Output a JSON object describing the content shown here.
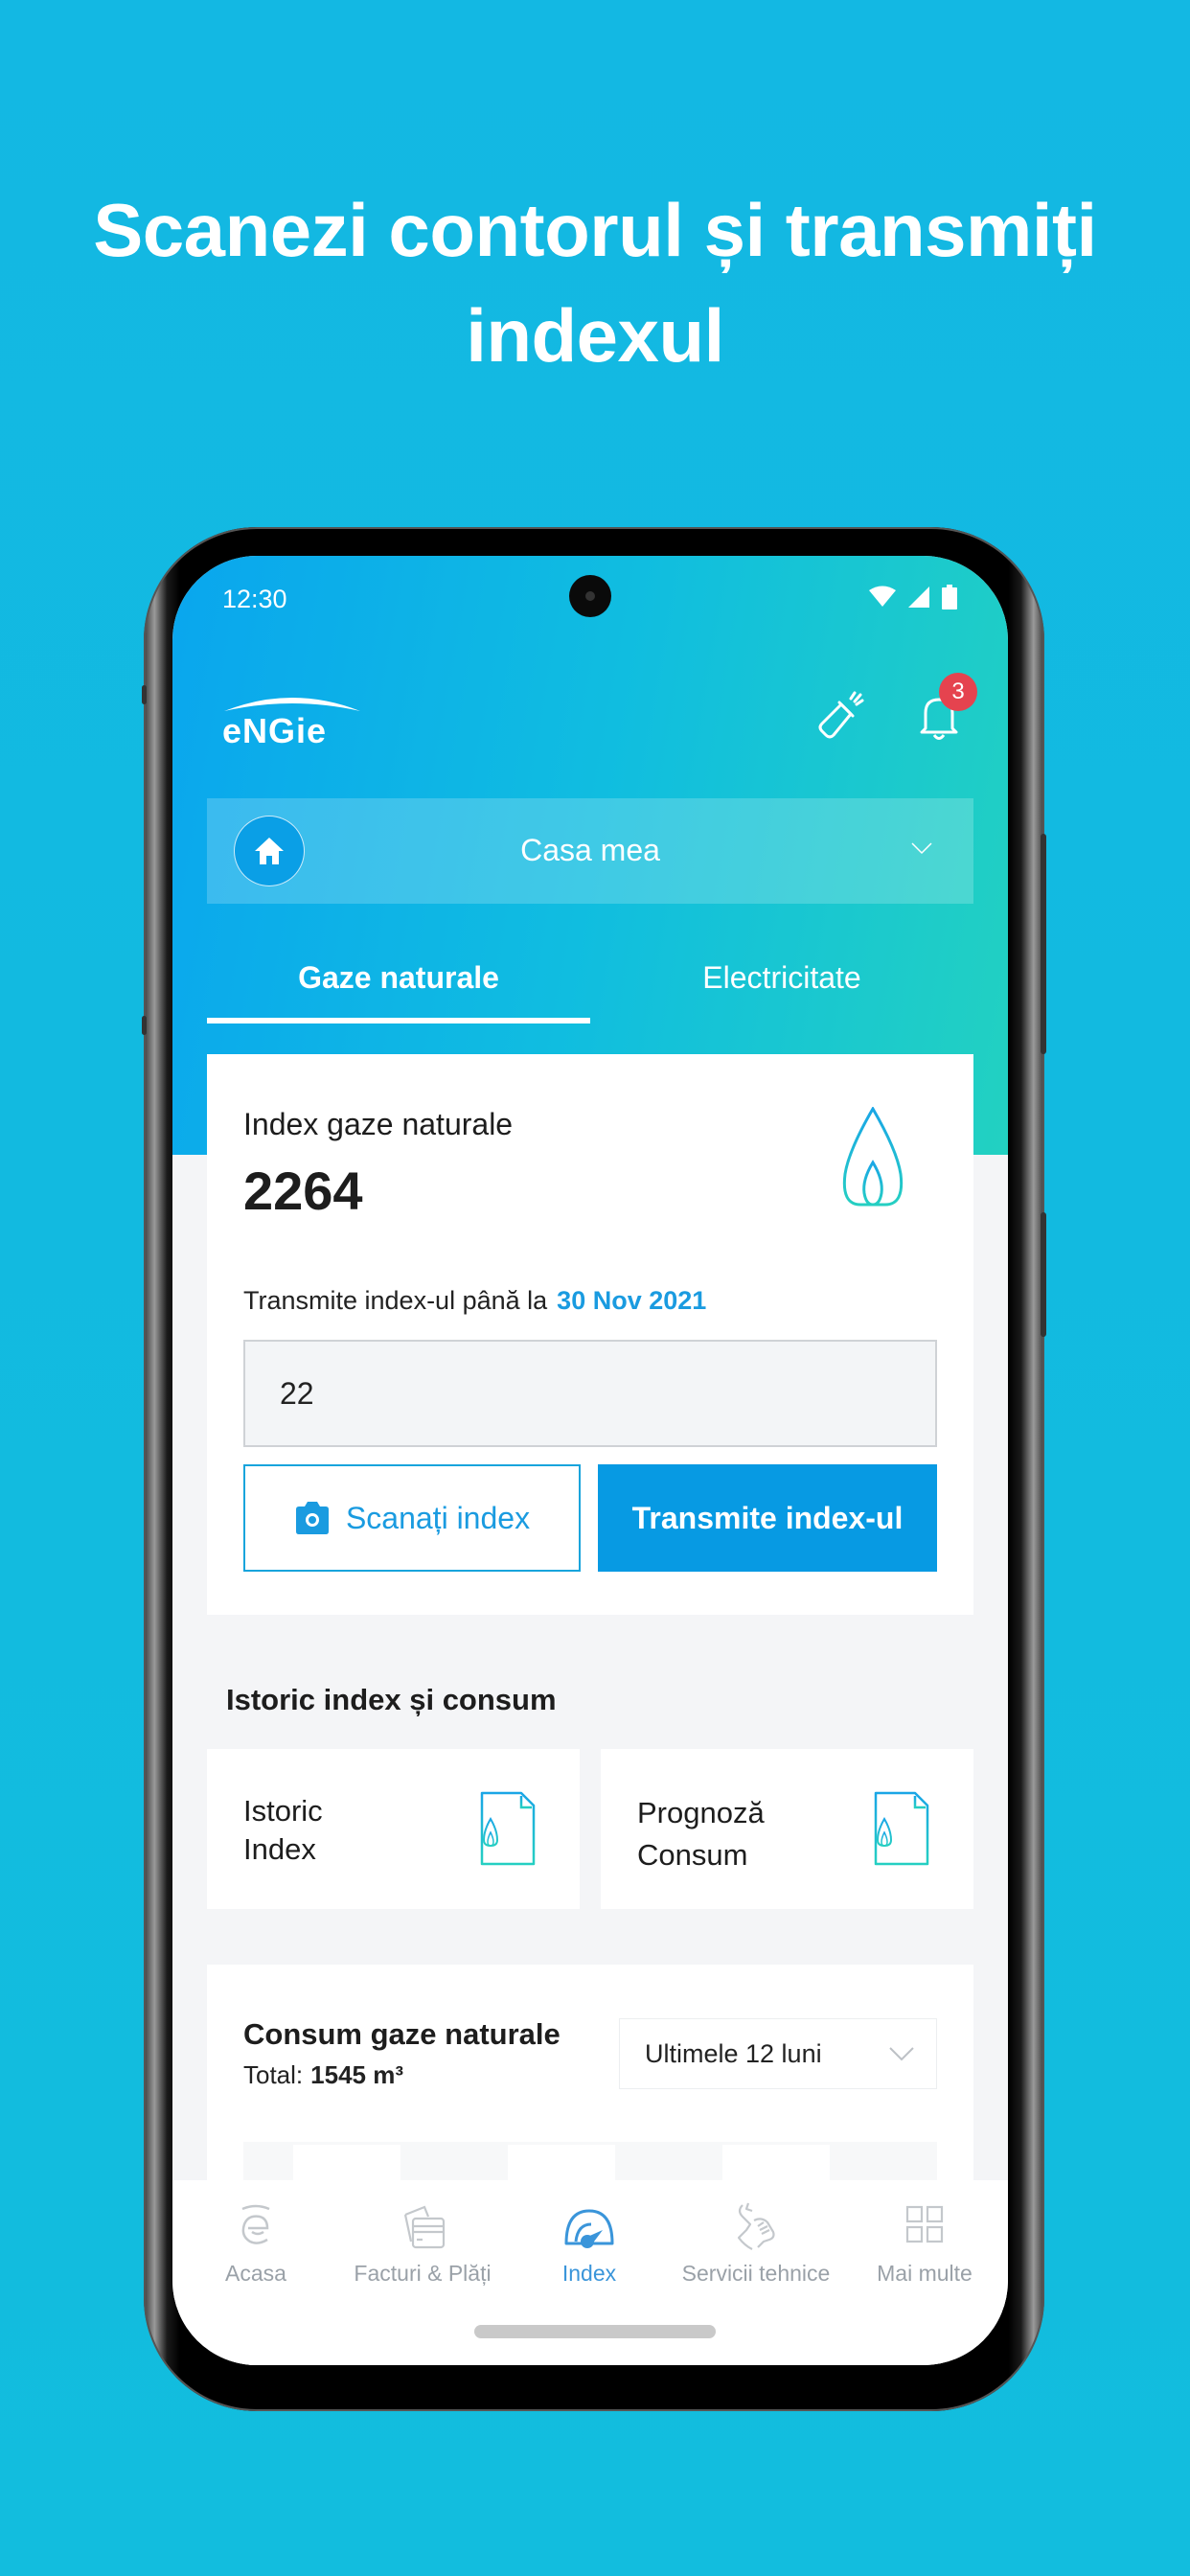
{
  "headline": {
    "line1": "Scanezi contorul și transmiți",
    "line2": "indexul"
  },
  "status_bar": {
    "time": "12:30",
    "icons": [
      "wifi-icon",
      "signal-icon",
      "battery-icon"
    ]
  },
  "header": {
    "logo_text": "engie",
    "flashlight_icon": "flashlight-icon",
    "notifications_icon": "bell-icon",
    "notifications_count": "3"
  },
  "location_select": {
    "label": "Casa mea",
    "icon": "home-icon"
  },
  "tabs": [
    {
      "label": "Gaze naturale",
      "active": true
    },
    {
      "label": "Electricitate",
      "active": false
    }
  ],
  "index_card": {
    "title": "Index gaze naturale",
    "value": "2264",
    "deadline_prefix": "Transmite index-ul până la",
    "deadline_date": "30 Nov 2021",
    "input_value": "22",
    "scan_button": "Scanați index",
    "submit_button": "Transmite index-ul",
    "accent_color": "#079ae3"
  },
  "history_section": {
    "title": "Istoric index și consum",
    "tiles": [
      {
        "line1": "Istoric",
        "line2": "Index"
      },
      {
        "line1": "Prognoză",
        "line2": "Consum"
      }
    ]
  },
  "consumption_card": {
    "title": "Consum gaze naturale",
    "total_label": "Total:",
    "total_value": "1545 m³",
    "period_select": "Ultimele 12 luni"
  },
  "bottom_nav": [
    {
      "label": "Acasa",
      "icon": "engie-home-icon",
      "active": false
    },
    {
      "label": "Facturi & Plăți",
      "icon": "invoice-card-icon",
      "active": false
    },
    {
      "label": "Index",
      "icon": "gauge-icon",
      "active": true
    },
    {
      "label": "Servicii tehnice",
      "icon": "wrench-hand-icon",
      "active": false
    },
    {
      "label": "Mai multe",
      "icon": "grid-icon",
      "active": false
    }
  ]
}
